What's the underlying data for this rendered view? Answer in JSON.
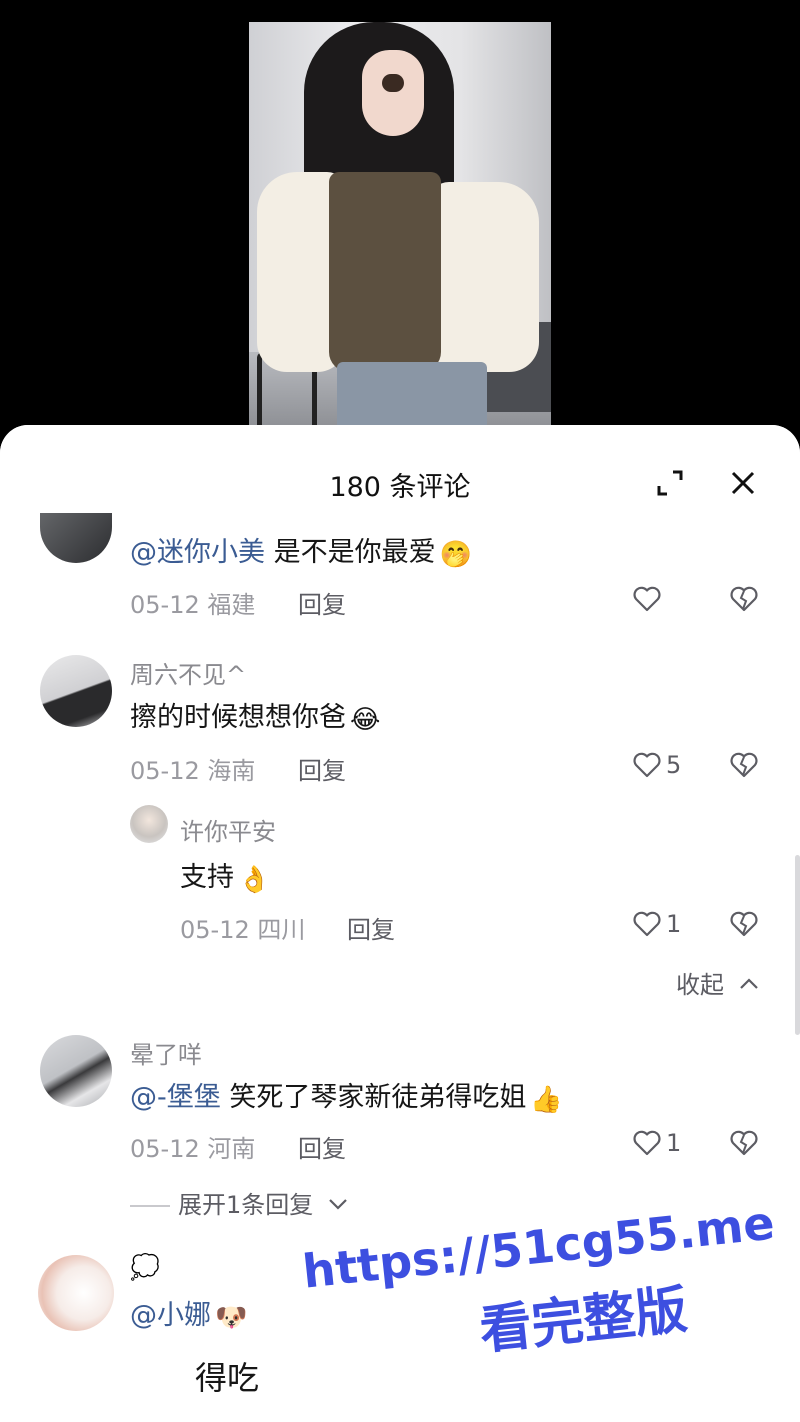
{
  "sheet": {
    "title": "180 条评论"
  },
  "comments": [
    {
      "mention": "@迷你小美",
      "text": " 是不是你最爱",
      "emoji": "🤭",
      "date": "05-12",
      "location": "福建",
      "reply_label": "回复",
      "likes": ""
    },
    {
      "username": "周六不见^",
      "text": "擦的时候想想你爸",
      "emoji": "😂",
      "date": "05-12",
      "location": "海南",
      "reply_label": "回复",
      "likes": "5"
    },
    {
      "username": "许你平安",
      "text": "支持",
      "emoji": "👌",
      "date": "05-12",
      "location": "四川",
      "reply_label": "回复",
      "likes": "1"
    },
    {
      "username": "晕了咩",
      "mention": "@-堡堡",
      "text": " 笑死了琴家新徒弟得吃姐",
      "emoji": "👍",
      "date": "05-12",
      "location": "河南",
      "reply_label": "回复",
      "likes": "1"
    },
    {
      "username": "💭",
      "mention": "@小娜",
      "emoji": "🐶",
      "text": "得吃"
    }
  ],
  "collapse_label": "收起",
  "expand_replies_label": "展开1条回复",
  "watermark": {
    "line1": "https://51cg55.me",
    "line2": "看完整版"
  },
  "colors": {
    "mention": "#3b5c93",
    "watermark": "#3d4fe0"
  }
}
